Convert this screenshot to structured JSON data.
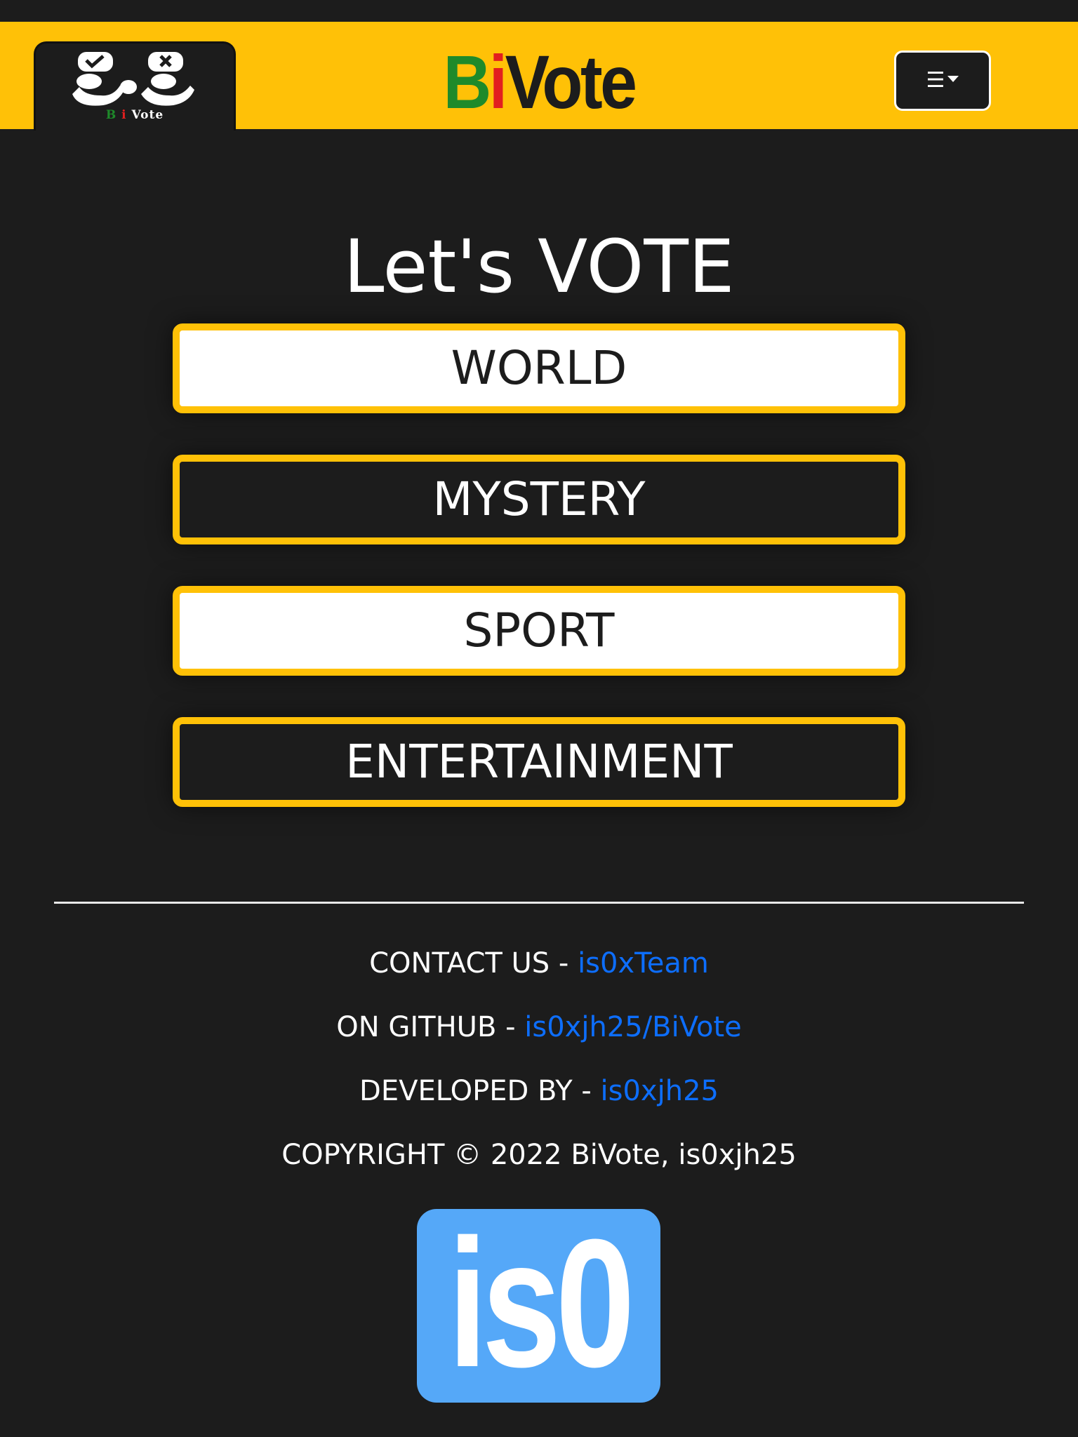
{
  "header": {
    "logo_text_b": "B",
    "logo_text_i": "i",
    "logo_text_rest": "Vote",
    "brand_b": "B",
    "brand_i": "i",
    "brand_rest": "Vote",
    "menu_icon": "hamburger-icon",
    "colors": {
      "bar": "#ffc107",
      "green": "#1e8a2a",
      "red": "#e21f1f"
    }
  },
  "main": {
    "title": "Let's VOTE",
    "categories": [
      {
        "label": "WORLD"
      },
      {
        "label": "MYSTERY"
      },
      {
        "label": "SPORT"
      },
      {
        "label": "ENTERTAINMENT"
      }
    ]
  },
  "footer": {
    "contact_label": "CONTACT US - ",
    "contact_link": "is0xTeam",
    "github_label": "ON GITHUB - ",
    "github_link": "is0xjh25/BiVote",
    "developed_label": "DEVELOPED BY - ",
    "developed_link": "is0xjh25",
    "copyright": "COPYRIGHT © 2022 BiVote, is0xjh25",
    "badge_text": "is0",
    "link_color": "#0d6efd",
    "badge_color": "#55a8f8"
  }
}
